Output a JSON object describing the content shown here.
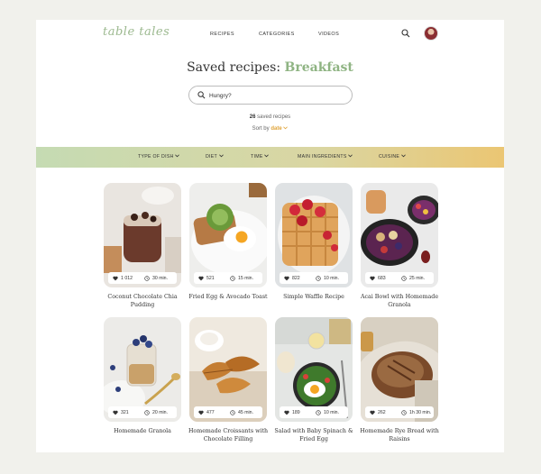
{
  "header": {
    "logo": "table tales",
    "nav": [
      "RECIPES",
      "CATEGORIES",
      "VIDEOS"
    ]
  },
  "title": {
    "prefix": "Saved recipes:",
    "accent": "Breakfast"
  },
  "search": {
    "placeholder": "Hungry?"
  },
  "count": {
    "number": "26",
    "label": "saved recipes"
  },
  "sort": {
    "label": "Sort by",
    "value": "date"
  },
  "filters": [
    "TYPE OF DISH",
    "DIET",
    "TIME",
    "MAIN INGREDIENTS",
    "CUISINE"
  ],
  "colors": {
    "accent_green": "#8fb483",
    "accent_orange": "#e0a43a",
    "filter_start": "#c5dbb3",
    "filter_end": "#ebc673"
  },
  "recipes": [
    {
      "name": "Coconut Chocolate Chia Pudding",
      "likes": "1 012",
      "time": "30 min.",
      "photo": "chia-pudding"
    },
    {
      "name": "Fried Egg & Avocado Toast",
      "likes": "521",
      "time": "15 min.",
      "photo": "avocado-toast"
    },
    {
      "name": "Simple Waffle Recipe",
      "likes": "822",
      "time": "10 min.",
      "photo": "waffles"
    },
    {
      "name": "Acai Bowl with Homemade Granola",
      "likes": "683",
      "time": "25 min.",
      "photo": "acai-bowl"
    },
    {
      "name": "Homemade Granola",
      "likes": "321",
      "time": "20 min.",
      "photo": "granola"
    },
    {
      "name": "Homemade Croissants with Chocolate Filling",
      "likes": "477",
      "time": "45 min.",
      "photo": "croissants"
    },
    {
      "name": "Salad with Baby Spinach & Fried Egg",
      "likes": "189",
      "time": "10 min.",
      "photo": "spinach-salad"
    },
    {
      "name": "Homemade Rye Bread with Raisins",
      "likes": "262",
      "time": "1h 30 min.",
      "photo": "rye-bread"
    }
  ],
  "icons": {
    "search": "search-icon",
    "heart": "heart-icon",
    "clock": "clock-icon",
    "chevron": "chevron-down-icon"
  }
}
